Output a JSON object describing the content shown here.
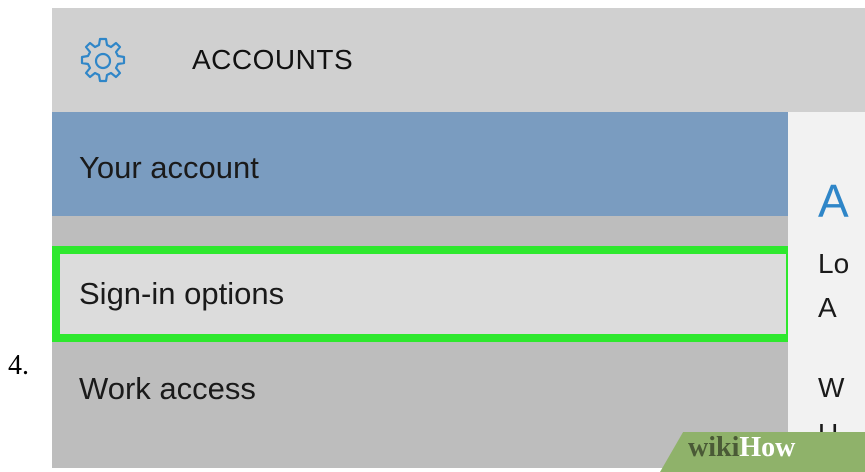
{
  "step": {
    "number": "4."
  },
  "header": {
    "title": "ACCOUNTS",
    "icon": "gear-icon"
  },
  "sidebar": {
    "items": [
      {
        "label": "Your account",
        "state": "active"
      },
      {
        "label": "Sign-in options",
        "state": "highlighted"
      },
      {
        "label": "Work access",
        "state": "normal"
      }
    ]
  },
  "content": {
    "heading": "A",
    "lines": [
      "Lo",
      "A",
      "W",
      "U"
    ]
  },
  "watermark": {
    "part1": "wiki",
    "part2": "How"
  },
  "colors": {
    "accent": "#2f86c8",
    "active_nav": "#7a9cc0",
    "highlight_border": "#2ee82e",
    "icon_blue": "#2f86c8"
  }
}
